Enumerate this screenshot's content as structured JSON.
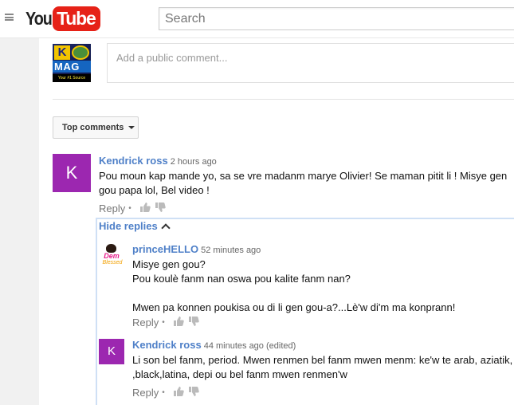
{
  "header": {
    "logo_you": "You",
    "logo_tube": "Tube",
    "search_placeholder": "Search"
  },
  "channel": {
    "thumb_text_1": "K",
    "thumb_text_2": "MAG",
    "thumb_text_3": "Your #1 Source"
  },
  "comment_box": {
    "placeholder": "Add a public comment..."
  },
  "sort": {
    "label": "Top comments"
  },
  "comments": [
    {
      "avatar_letter": "K",
      "author": "Kendrick ross",
      "time": "2 hours ago",
      "text": "Pou moun kap mande yo, sa se vre madanm marye Olivier! Se maman pitit li  ! Misye gen\ngou papa lol, Bel video !",
      "reply_label": "Reply"
    }
  ],
  "replies": {
    "toggle_label": "Hide replies",
    "items": [
      {
        "avatar_text_1": "Dem",
        "avatar_text_2": "Blessed",
        "author": "princeHELLO",
        "time": "52 minutes ago",
        "text": "Misye gen gou?\nPou koulè fanm nan oswa pou kalite fanm nan?\n\nMwen pa konnen poukisa ou di li gen gou-a?...Lè'w di'm ma konprann!",
        "reply_label": "Reply"
      },
      {
        "avatar_letter": "K",
        "author": "Kendrick ross",
        "time": "44 minutes ago (edited)",
        "text": "Li son bel fanm, period. Mwen renmen bel fanm mwen menm: ke'w te arab, aziatik,\n,black,latina, depi ou bel fanm mwen renmen'w",
        "reply_label": "Reply"
      }
    ]
  },
  "colors": {
    "author_link": "#4f80c8",
    "avatar_purple": "#9c27b0",
    "youtube_red": "#e62117",
    "replies_border": "#cfe0f5"
  }
}
